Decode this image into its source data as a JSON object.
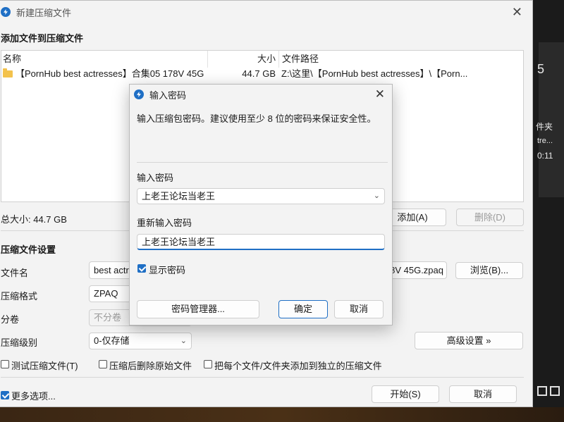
{
  "window": {
    "title": "新建压缩文件",
    "close_glyph": "✕"
  },
  "add_section": {
    "title": "添加文件到压缩文件",
    "columns": {
      "name": "名称",
      "size": "大小",
      "path": "文件路径"
    },
    "rows": [
      {
        "name": "【PornHub best actresses】合集05 178V 45G",
        "size": "44.7 GB",
        "path": "Z:\\这里\\【PornHub best actresses】\\【Porn..."
      }
    ],
    "total_size": "总大小: 44.7 GB",
    "add_button": "添加(A)",
    "delete_button": "删除(D)"
  },
  "settings": {
    "title": "压缩文件设置",
    "filename_label": "文件名",
    "filename_value_start": "best actr",
    "filename_value_end": "8V 45G.zpaq",
    "browse_button": "浏览(B)...",
    "format_label": "压缩格式",
    "format_value": "ZPAQ",
    "split_label": "分卷",
    "split_value": "不分卷",
    "level_label": "压缩级别",
    "level_value": "0-仅存储",
    "advanced_button": "高级设置 »",
    "opt_test": "测试压缩文件(T)",
    "opt_delete": "压缩后删除原始文件",
    "opt_each": "把每个文件/文件夹添加到独立的压缩文件",
    "more_options": "更多选项...",
    "start_button": "开始(S)",
    "cancel_button": "取消"
  },
  "password_dialog": {
    "title": "输入密码",
    "close_glyph": "✕",
    "description": "输入压缩包密码。建议使用至少 8 位的密码来保证安全性。",
    "password_label": "输入密码",
    "password_value": "上老王论坛当老王",
    "confirm_label": "重新输入密码",
    "confirm_value": "上老王论坛当老王",
    "show_password": "显示密码",
    "show_password_checked": true,
    "manager_button": "密码管理器...",
    "ok_button": "确定",
    "cancel_button": "取消"
  },
  "background": {
    "texts": [
      "5",
      "件夹",
      "tre...",
      "0:11"
    ]
  },
  "colors": {
    "accent": "#1f6fc5",
    "dialog_bg": "#f3f3f3",
    "window_bg": "#f3f3f3"
  }
}
